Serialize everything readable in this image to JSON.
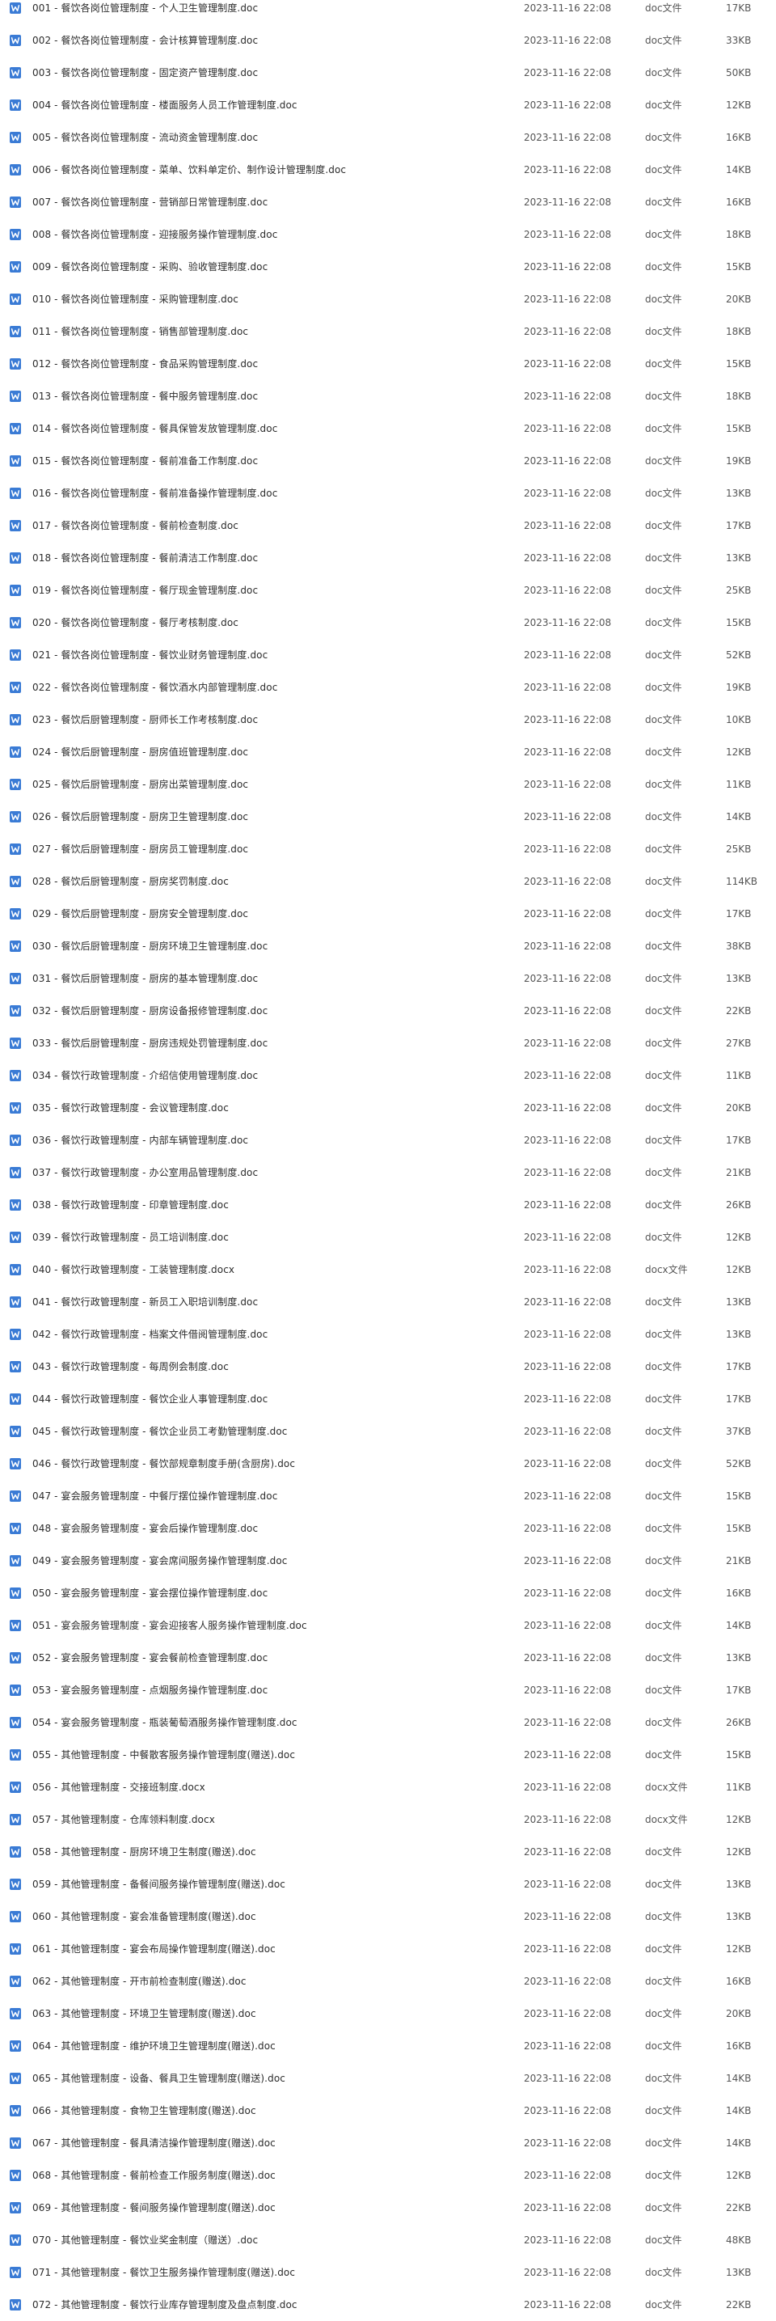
{
  "files": [
    {
      "name": "001 - 餐饮各岗位管理制度 - 个人卫生管理制度.doc",
      "date": "2023-11-16 22:08",
      "type": "doc文件",
      "size": "17KB"
    },
    {
      "name": "002 - 餐饮各岗位管理制度 - 会计核算管理制度.doc",
      "date": "2023-11-16 22:08",
      "type": "doc文件",
      "size": "33KB"
    },
    {
      "name": "003 - 餐饮各岗位管理制度 - 固定资产管理制度.doc",
      "date": "2023-11-16 22:08",
      "type": "doc文件",
      "size": "50KB"
    },
    {
      "name": "004 - 餐饮各岗位管理制度 - 楼面服务人员工作管理制度.doc",
      "date": "2023-11-16 22:08",
      "type": "doc文件",
      "size": "12KB"
    },
    {
      "name": "005 - 餐饮各岗位管理制度 - 流动资金管理制度.doc",
      "date": "2023-11-16 22:08",
      "type": "doc文件",
      "size": "16KB"
    },
    {
      "name": "006 - 餐饮各岗位管理制度 - 菜单、饮料单定价、制作设计管理制度.doc",
      "date": "2023-11-16 22:08",
      "type": "doc文件",
      "size": "14KB"
    },
    {
      "name": "007 - 餐饮各岗位管理制度 - 营销部日常管理制度.doc",
      "date": "2023-11-16 22:08",
      "type": "doc文件",
      "size": "16KB"
    },
    {
      "name": "008 - 餐饮各岗位管理制度 - 迎接服务操作管理制度.doc",
      "date": "2023-11-16 22:08",
      "type": "doc文件",
      "size": "18KB"
    },
    {
      "name": "009 - 餐饮各岗位管理制度 - 采购、验收管理制度.doc",
      "date": "2023-11-16 22:08",
      "type": "doc文件",
      "size": "15KB"
    },
    {
      "name": "010 - 餐饮各岗位管理制度 - 采购管理制度.doc",
      "date": "2023-11-16 22:08",
      "type": "doc文件",
      "size": "20KB"
    },
    {
      "name": "011 - 餐饮各岗位管理制度 - 销售部管理制度.doc",
      "date": "2023-11-16 22:08",
      "type": "doc文件",
      "size": "18KB"
    },
    {
      "name": "012 - 餐饮各岗位管理制度 - 食品采购管理制度.doc",
      "date": "2023-11-16 22:08",
      "type": "doc文件",
      "size": "15KB"
    },
    {
      "name": "013 - 餐饮各岗位管理制度 - 餐中服务管理制度.doc",
      "date": "2023-11-16 22:08",
      "type": "doc文件",
      "size": "18KB"
    },
    {
      "name": "014 - 餐饮各岗位管理制度 - 餐具保管发放管理制度.doc",
      "date": "2023-11-16 22:08",
      "type": "doc文件",
      "size": "15KB"
    },
    {
      "name": "015 - 餐饮各岗位管理制度 - 餐前准备工作制度.doc",
      "date": "2023-11-16 22:08",
      "type": "doc文件",
      "size": "19KB"
    },
    {
      "name": "016 - 餐饮各岗位管理制度 - 餐前准备操作管理制度.doc",
      "date": "2023-11-16 22:08",
      "type": "doc文件",
      "size": "13KB"
    },
    {
      "name": "017 - 餐饮各岗位管理制度 - 餐前检查制度.doc",
      "date": "2023-11-16 22:08",
      "type": "doc文件",
      "size": "17KB"
    },
    {
      "name": "018 - 餐饮各岗位管理制度 - 餐前清洁工作制度.doc",
      "date": "2023-11-16 22:08",
      "type": "doc文件",
      "size": "13KB"
    },
    {
      "name": "019 - 餐饮各岗位管理制度 - 餐厅现金管理制度.doc",
      "date": "2023-11-16 22:08",
      "type": "doc文件",
      "size": "25KB"
    },
    {
      "name": "020 - 餐饮各岗位管理制度 - 餐厅考核制度.doc",
      "date": "2023-11-16 22:08",
      "type": "doc文件",
      "size": "15KB"
    },
    {
      "name": "021 - 餐饮各岗位管理制度 - 餐饮业财务管理制度.doc",
      "date": "2023-11-16 22:08",
      "type": "doc文件",
      "size": "52KB"
    },
    {
      "name": "022 - 餐饮各岗位管理制度 - 餐饮酒水内部管理制度.doc",
      "date": "2023-11-16 22:08",
      "type": "doc文件",
      "size": "19KB"
    },
    {
      "name": "023 - 餐饮后厨管理制度 - 厨师长工作考核制度.doc",
      "date": "2023-11-16 22:08",
      "type": "doc文件",
      "size": "10KB"
    },
    {
      "name": "024 - 餐饮后厨管理制度 - 厨房值班管理制度.doc",
      "date": "2023-11-16 22:08",
      "type": "doc文件",
      "size": "12KB"
    },
    {
      "name": "025 - 餐饮后厨管理制度 - 厨房出菜管理制度.doc",
      "date": "2023-11-16 22:08",
      "type": "doc文件",
      "size": "11KB"
    },
    {
      "name": "026 - 餐饮后厨管理制度 - 厨房卫生管理制度.doc",
      "date": "2023-11-16 22:08",
      "type": "doc文件",
      "size": "14KB"
    },
    {
      "name": "027 - 餐饮后厨管理制度 - 厨房员工管理制度.doc",
      "date": "2023-11-16 22:08",
      "type": "doc文件",
      "size": "25KB"
    },
    {
      "name": "028 - 餐饮后厨管理制度 - 厨房奖罚制度.doc",
      "date": "2023-11-16 22:08",
      "type": "doc文件",
      "size": "114KB"
    },
    {
      "name": "029 - 餐饮后厨管理制度 - 厨房安全管理制度.doc",
      "date": "2023-11-16 22:08",
      "type": "doc文件",
      "size": "17KB"
    },
    {
      "name": "030 - 餐饮后厨管理制度 - 厨房环境卫生管理制度.doc",
      "date": "2023-11-16 22:08",
      "type": "doc文件",
      "size": "38KB"
    },
    {
      "name": "031 - 餐饮后厨管理制度 - 厨房的基本管理制度.doc",
      "date": "2023-11-16 22:08",
      "type": "doc文件",
      "size": "13KB"
    },
    {
      "name": "032 - 餐饮后厨管理制度 - 厨房设备报修管理制度.doc",
      "date": "2023-11-16 22:08",
      "type": "doc文件",
      "size": "22KB"
    },
    {
      "name": "033 - 餐饮后厨管理制度 - 厨房违规处罚管理制度.doc",
      "date": "2023-11-16 22:08",
      "type": "doc文件",
      "size": "27KB"
    },
    {
      "name": "034 - 餐饮行政管理制度 - 介绍信使用管理制度.doc",
      "date": "2023-11-16 22:08",
      "type": "doc文件",
      "size": "11KB"
    },
    {
      "name": "035 - 餐饮行政管理制度 - 会议管理制度.doc",
      "date": "2023-11-16 22:08",
      "type": "doc文件",
      "size": "20KB"
    },
    {
      "name": "036 - 餐饮行政管理制度 - 内部车辆管理制度.doc",
      "date": "2023-11-16 22:08",
      "type": "doc文件",
      "size": "17KB"
    },
    {
      "name": "037 - 餐饮行政管理制度 - 办公室用品管理制度.doc",
      "date": "2023-11-16 22:08",
      "type": "doc文件",
      "size": "21KB"
    },
    {
      "name": "038 - 餐饮行政管理制度 - 印章管理制度.doc",
      "date": "2023-11-16 22:08",
      "type": "doc文件",
      "size": "26KB"
    },
    {
      "name": "039 - 餐饮行政管理制度 - 员工培训制度.doc",
      "date": "2023-11-16 22:08",
      "type": "doc文件",
      "size": "12KB"
    },
    {
      "name": "040 - 餐饮行政管理制度 - 工装管理制度.docx",
      "date": "2023-11-16 22:08",
      "type": "docx文件",
      "size": "12KB"
    },
    {
      "name": "041 - 餐饮行政管理制度 - 新员工入职培训制度.doc",
      "date": "2023-11-16 22:08",
      "type": "doc文件",
      "size": "13KB"
    },
    {
      "name": "042 - 餐饮行政管理制度 - 档案文件借阅管理制度.doc",
      "date": "2023-11-16 22:08",
      "type": "doc文件",
      "size": "13KB"
    },
    {
      "name": "043 - 餐饮行政管理制度 - 每周例会制度.doc",
      "date": "2023-11-16 22:08",
      "type": "doc文件",
      "size": "17KB"
    },
    {
      "name": "044 - 餐饮行政管理制度 - 餐饮企业人事管理制度.doc",
      "date": "2023-11-16 22:08",
      "type": "doc文件",
      "size": "17KB"
    },
    {
      "name": "045 - 餐饮行政管理制度 - 餐饮企业员工考勤管理制度.doc",
      "date": "2023-11-16 22:08",
      "type": "doc文件",
      "size": "37KB"
    },
    {
      "name": "046 - 餐饮行政管理制度 - 餐饮部规章制度手册(含厨房).doc",
      "date": "2023-11-16 22:08",
      "type": "doc文件",
      "size": "52KB"
    },
    {
      "name": "047 - 宴会服务管理制度 - 中餐厅摆位操作管理制度.doc",
      "date": "2023-11-16 22:08",
      "type": "doc文件",
      "size": "15KB"
    },
    {
      "name": "048 - 宴会服务管理制度 - 宴会后操作管理制度.doc",
      "date": "2023-11-16 22:08",
      "type": "doc文件",
      "size": "15KB"
    },
    {
      "name": "049 - 宴会服务管理制度 - 宴会席间服务操作管理制度.doc",
      "date": "2023-11-16 22:08",
      "type": "doc文件",
      "size": "21KB"
    },
    {
      "name": "050 - 宴会服务管理制度 - 宴会摆位操作管理制度.doc",
      "date": "2023-11-16 22:08",
      "type": "doc文件",
      "size": "16KB"
    },
    {
      "name": "051 - 宴会服务管理制度 - 宴会迎接客人服务操作管理制度.doc",
      "date": "2023-11-16 22:08",
      "type": "doc文件",
      "size": "14KB"
    },
    {
      "name": "052 - 宴会服务管理制度 - 宴会餐前检查管理制度.doc",
      "date": "2023-11-16 22:08",
      "type": "doc文件",
      "size": "13KB"
    },
    {
      "name": "053 - 宴会服务管理制度 - 点烟服务操作管理制度.doc",
      "date": "2023-11-16 22:08",
      "type": "doc文件",
      "size": "17KB"
    },
    {
      "name": "054 - 宴会服务管理制度 - 瓶装葡萄酒服务操作管理制度.doc",
      "date": "2023-11-16 22:08",
      "type": "doc文件",
      "size": "26KB"
    },
    {
      "name": "055 - 其他管理制度 - 中餐散客服务操作管理制度(赠送).doc",
      "date": "2023-11-16 22:08",
      "type": "doc文件",
      "size": "15KB"
    },
    {
      "name": "056 - 其他管理制度 - 交接班制度.docx",
      "date": "2023-11-16 22:08",
      "type": "docx文件",
      "size": "11KB"
    },
    {
      "name": "057 - 其他管理制度 - 仓库领料制度.docx",
      "date": "2023-11-16 22:08",
      "type": "docx文件",
      "size": "12KB"
    },
    {
      "name": "058 - 其他管理制度 - 厨房环境卫生制度(赠送).doc",
      "date": "2023-11-16 22:08",
      "type": "doc文件",
      "size": "12KB"
    },
    {
      "name": "059 - 其他管理制度 - 备餐间服务操作管理制度(赠送).doc",
      "date": "2023-11-16 22:08",
      "type": "doc文件",
      "size": "13KB"
    },
    {
      "name": "060 - 其他管理制度 - 宴会准备管理制度(赠送).doc",
      "date": "2023-11-16 22:08",
      "type": "doc文件",
      "size": "13KB"
    },
    {
      "name": "061 - 其他管理制度 - 宴会布局操作管理制度(赠送).doc",
      "date": "2023-11-16 22:08",
      "type": "doc文件",
      "size": "12KB"
    },
    {
      "name": "062 - 其他管理制度 - 开市前检查制度(赠送).doc",
      "date": "2023-11-16 22:08",
      "type": "doc文件",
      "size": "16KB"
    },
    {
      "name": "063 - 其他管理制度 - 环境卫生管理制度(赠送).doc",
      "date": "2023-11-16 22:08",
      "type": "doc文件",
      "size": "20KB"
    },
    {
      "name": "064 - 其他管理制度 - 维护环境卫生管理制度(赠送).doc",
      "date": "2023-11-16 22:08",
      "type": "doc文件",
      "size": "16KB"
    },
    {
      "name": "065 - 其他管理制度 - 设备、餐具卫生管理制度(赠送).doc",
      "date": "2023-11-16 22:08",
      "type": "doc文件",
      "size": "14KB"
    },
    {
      "name": "066 - 其他管理制度 - 食物卫生管理制度(赠送).doc",
      "date": "2023-11-16 22:08",
      "type": "doc文件",
      "size": "14KB"
    },
    {
      "name": "067 - 其他管理制度 - 餐具清洁操作管理制度(赠送).doc",
      "date": "2023-11-16 22:08",
      "type": "doc文件",
      "size": "14KB"
    },
    {
      "name": "068 - 其他管理制度 - 餐前检查工作服务制度(赠送).doc",
      "date": "2023-11-16 22:08",
      "type": "doc文件",
      "size": "12KB"
    },
    {
      "name": "069 - 其他管理制度 - 餐间服务操作管理制度(赠送).doc",
      "date": "2023-11-16 22:08",
      "type": "doc文件",
      "size": "22KB"
    },
    {
      "name": "070 - 其他管理制度 - 餐饮业奖金制度（赠送）.doc",
      "date": "2023-11-16 22:08",
      "type": "doc文件",
      "size": "48KB"
    },
    {
      "name": "071 - 其他管理制度 - 餐饮卫生服务操作管理制度(赠送).doc",
      "date": "2023-11-16 22:08",
      "type": "doc文件",
      "size": "13KB"
    },
    {
      "name": "072 - 其他管理制度 - 餐饮行业库存管理制度及盘点制度.doc",
      "date": "2023-11-16 22:08",
      "type": "doc文件",
      "size": "22KB"
    }
  ],
  "icon": {
    "name": "word-doc-icon",
    "color": "#3a7bd5"
  }
}
